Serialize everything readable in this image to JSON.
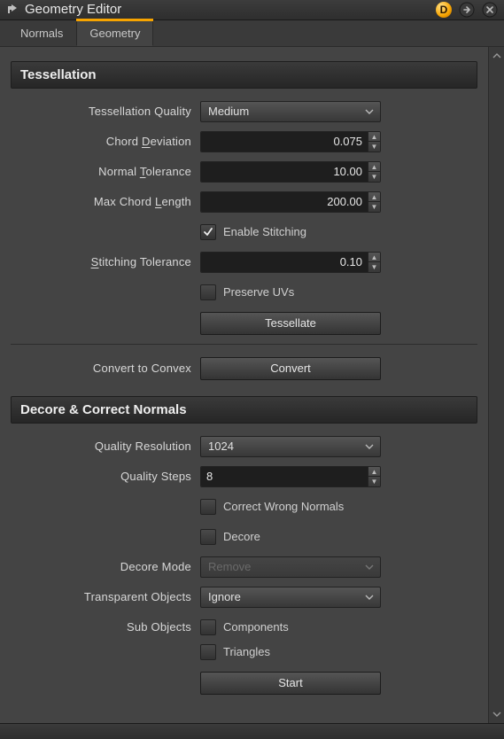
{
  "titlebar": {
    "title": "Geometry Editor",
    "d_badge": "D"
  },
  "tabs": {
    "normals": "Normals",
    "geometry": "Geometry",
    "active": "geometry"
  },
  "tessellation": {
    "heading": "Tessellation",
    "quality_label": "Tessellation Quality",
    "quality_value": "Medium",
    "chord_dev_label_pre": "Chord ",
    "chord_dev_label_ul": "D",
    "chord_dev_label_post": "eviation",
    "chord_dev_value": "0.075",
    "normal_tol_label_pre": "Normal ",
    "normal_tol_label_ul": "T",
    "normal_tol_label_post": "olerance",
    "normal_tol_value": "10.00",
    "max_chord_label_pre": "Max Chord ",
    "max_chord_label_ul": "L",
    "max_chord_label_post": "ength",
    "max_chord_value": "200.00",
    "enable_stitching_label": "Enable Stitching",
    "enable_stitching_checked": true,
    "stitch_tol_label_ul": "S",
    "stitch_tol_label_post": "titching Tolerance",
    "stitch_tol_value": "0.10",
    "preserve_uvs_label": "Preserve UVs",
    "preserve_uvs_checked": false,
    "tessellate_btn": "Tessellate",
    "convert_label": "Convert to Convex",
    "convert_btn": "Convert"
  },
  "decore": {
    "heading": "Decore & Correct Normals",
    "quality_res_label": "Quality Resolution",
    "quality_res_value": "1024",
    "quality_steps_label": "Quality Steps",
    "quality_steps_value": "8",
    "correct_normals_label": "Correct Wrong Normals",
    "correct_normals_checked": false,
    "decore_label": "Decore",
    "decore_checked": false,
    "decore_mode_label": "Decore Mode",
    "decore_mode_value": "Remove",
    "transparent_label": "Transparent Objects",
    "transparent_value": "Ignore",
    "subobjects_label": "Sub Objects",
    "components_label": "Components",
    "components_checked": false,
    "triangles_label": "Triangles",
    "triangles_checked": false,
    "start_btn": "Start"
  }
}
